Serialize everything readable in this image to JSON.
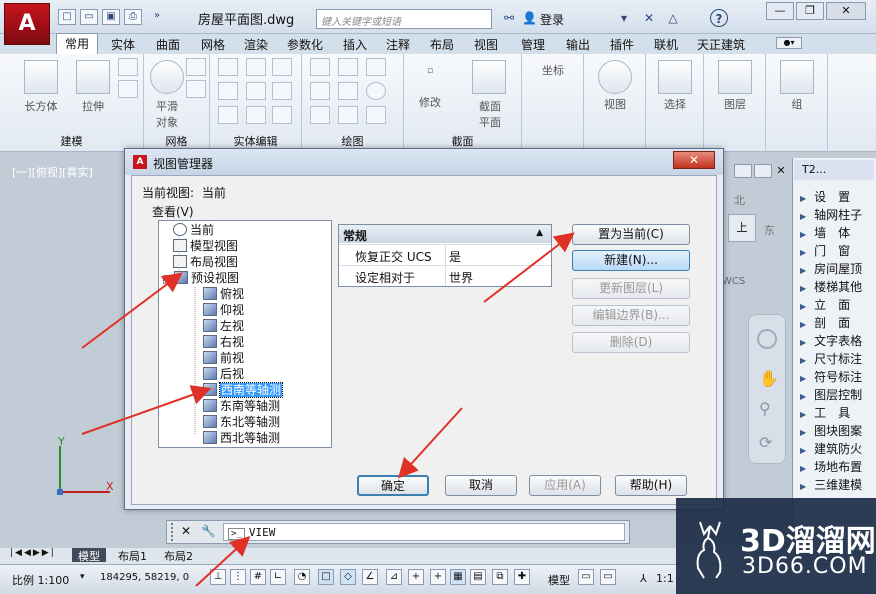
{
  "titlebar": {
    "doc_title": "房屋平面图.dwg",
    "search_placeholder": "键入关键字或短语",
    "login": "登录",
    "app_logo": "A",
    "window_buttons": [
      "—",
      "❐",
      "✕"
    ]
  },
  "ribbon": {
    "tabs": [
      "常用",
      "实体",
      "曲面",
      "网格",
      "渲染",
      "参数化",
      "插入",
      "注释",
      "布局",
      "视图",
      "管理",
      "输出",
      "插件",
      "联机",
      "天正建筑"
    ],
    "active_tab": "常用",
    "panels": [
      {
        "label": "建模",
        "buttons": [
          "长方体",
          "拉伸"
        ]
      },
      {
        "label": "网格",
        "buttons": [
          "平滑",
          "对象"
        ]
      },
      {
        "label": "实体编辑",
        "buttons": []
      },
      {
        "label": "绘图",
        "buttons": []
      },
      {
        "label": "截面",
        "buttons": [
          "修改",
          "截面",
          "平面"
        ]
      },
      {
        "label": "",
        "buttons": [
          "坐标"
        ]
      },
      {
        "label": "",
        "buttons": [
          "视图"
        ]
      },
      {
        "label": "",
        "buttons": [
          "选择"
        ]
      },
      {
        "label": "",
        "buttons": [
          "图层"
        ]
      },
      {
        "label": "",
        "buttons": [
          "组"
        ]
      }
    ]
  },
  "viewport_label": "[一][俯视][真实]",
  "ucs": {
    "y": "Y",
    "x": "X"
  },
  "viewcube": {
    "north": "北",
    "east": "东",
    "top": "上",
    "wcs": "WCS"
  },
  "palette": {
    "title": "T2...",
    "items": [
      "设　置",
      "轴网柱子",
      "墙　体",
      "门　窗",
      "房间屋顶",
      "楼梯其他",
      "立　面",
      "剖　面",
      "文字表格",
      "尺寸标注",
      "符号标注",
      "图层控制",
      "工　具",
      "图块图案",
      "建筑防火",
      "场地布置",
      "三维建模"
    ]
  },
  "dialog": {
    "title": "视图管理器",
    "icon": "A",
    "current_view_label": "当前视图:",
    "current_view_value": "当前",
    "look_in_label": "查看(V)",
    "tree": [
      {
        "label": "当前",
        "icon": "mag",
        "level": 1
      },
      {
        "label": "模型视图",
        "icon": "sheet",
        "level": 1
      },
      {
        "label": "布局视图",
        "icon": "sheet",
        "level": 1
      },
      {
        "label": "预设视图",
        "icon": "cube",
        "level": 1
      },
      {
        "label": "俯视",
        "icon": "cube",
        "level": 2
      },
      {
        "label": "仰视",
        "icon": "cube",
        "level": 2
      },
      {
        "label": "左视",
        "icon": "cube",
        "level": 2
      },
      {
        "label": "右视",
        "icon": "cube",
        "level": 2
      },
      {
        "label": "前视",
        "icon": "cube",
        "level": 2
      },
      {
        "label": "后视",
        "icon": "cube",
        "level": 2
      },
      {
        "label": "西南等轴测",
        "icon": "cube",
        "level": 2,
        "selected": true
      },
      {
        "label": "东南等轴测",
        "icon": "cube",
        "level": 2
      },
      {
        "label": "东北等轴测",
        "icon": "cube",
        "level": 2
      },
      {
        "label": "西北等轴测",
        "icon": "cube",
        "level": 2
      }
    ],
    "properties": {
      "header": "常规",
      "rows": [
        {
          "key": "恢复正交 UCS",
          "value": "是"
        },
        {
          "key": "设定相对于",
          "value": "世界"
        }
      ]
    },
    "side_buttons": [
      {
        "label": "置为当前(C)",
        "enabled": true
      },
      {
        "label": "新建(N)...",
        "enabled": true,
        "focus": true
      },
      {
        "label": "更新图层(L)",
        "enabled": false
      },
      {
        "label": "编辑边界(B)...",
        "enabled": false
      },
      {
        "label": "删除(D)",
        "enabled": false
      }
    ],
    "bottom_buttons": [
      {
        "label": "确定",
        "enabled": true
      },
      {
        "label": "取消",
        "enabled": true
      },
      {
        "label": "应用(A)",
        "enabled": false
      },
      {
        "label": "帮助(H)",
        "enabled": true
      }
    ]
  },
  "command_line": {
    "value": "VIEW"
  },
  "layout_tabs": [
    "模型",
    "布局1",
    "布局2"
  ],
  "statusbar": {
    "scale": "比例 1:100",
    "coords": "184295, 58219, 0",
    "model_label": "模型",
    "anno_scale": "1:1"
  },
  "watermark": {
    "big": "3D溜溜网",
    "small": "3D66.COM"
  },
  "colors": {
    "accent": "#3399ff",
    "arrow": "#e03127",
    "brand": "#c8141e"
  }
}
